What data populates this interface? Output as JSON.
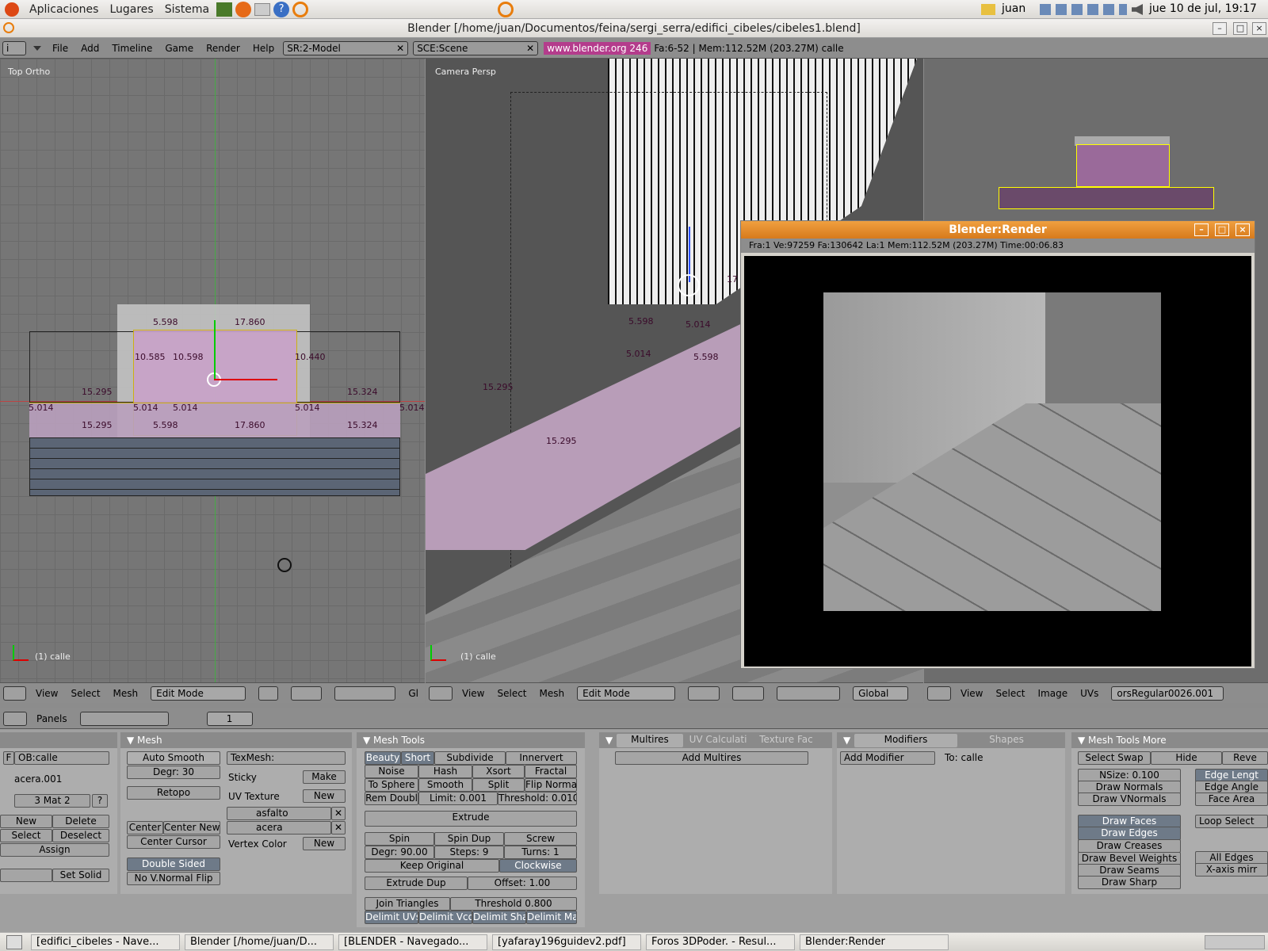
{
  "gnome_panel": {
    "menu_apps": "Aplicaciones",
    "menu_places": "Lugares",
    "menu_system": "Sistema",
    "user": "juan",
    "clock": "jue 10 de jul, 19:17"
  },
  "window": {
    "title": "Blender [/home/juan/Documentos/feina/sergi_serra/edifici_cibeles/cibeles1.blend]"
  },
  "blender_header": {
    "menus": [
      "File",
      "Add",
      "Timeline",
      "Game",
      "Render",
      "Help"
    ],
    "screen": "SR:2-Model",
    "scene": "SCE:Scene",
    "url": "www.blender.org 246",
    "stats": "Fa:6-52 | Mem:112.52M (203.27M) calle"
  },
  "view_left": {
    "label": "Top Ortho",
    "object": "(1) calle",
    "dims": [
      "5.598",
      "17.860",
      "10.585",
      "10.598",
      "10.440",
      "15.295",
      "15.324",
      "5.014",
      "5.014",
      "5.014",
      "5.014",
      "5.014",
      "15.295",
      "5.598",
      "17.860",
      "15.324"
    ]
  },
  "view_center": {
    "label": "Camera Persp",
    "object": "(1) calle",
    "dims": [
      "5.598",
      "5.014",
      "5.014",
      "5.598",
      "15.295",
      "15.295",
      "17"
    ]
  },
  "view_header_left": {
    "menus": [
      "View",
      "Select",
      "Mesh"
    ],
    "mode": "Edit Mode",
    "orient": "Gl"
  },
  "view_header_center": {
    "menus": [
      "View",
      "Select",
      "Mesh"
    ],
    "mode": "Edit Mode",
    "orient": "Global"
  },
  "view_header_right": {
    "menus": [
      "View",
      "Select",
      "Image",
      "UVs"
    ],
    "image": "orsRegular0026.001"
  },
  "render_window": {
    "title": "Blender:Render",
    "info": "Fra:1  Ve:97259 Fa:130642 La:1 Mem:112.52M (203.27M) Time:00:06.83"
  },
  "buttons_header": {
    "panels": "Panels",
    "frame": "1"
  },
  "link_panel": {
    "ob": "OB:calle",
    "mesh": "acera.001",
    "mat": "3 Mat 2",
    "q": "?",
    "new": "New",
    "delete": "Delete",
    "select": "Select",
    "deselect": "Deselect",
    "assign": "Assign",
    "set_solid": "Set Solid"
  },
  "mesh_panel": {
    "title": "Mesh",
    "auto_smooth": "Auto Smooth",
    "degr": "Degr: 30",
    "retopo": "Retopo",
    "center": "Center",
    "center_new": "Center New",
    "center_cursor": "Center Cursor",
    "double_sided": "Double Sided",
    "no_vnormal": "No V.Normal Flip",
    "texmesh": "TexMesh:",
    "sticky": "Sticky",
    "make": "Make",
    "uv_texture": "UV Texture",
    "new": "New",
    "uv1": "asfalto",
    "uv2": "acera",
    "vertex_color": "Vertex Color",
    "new2": "New"
  },
  "mesh_tools": {
    "title": "Mesh Tools",
    "row1": [
      "Beauty",
      "Short",
      "Subdivide",
      "Innervert"
    ],
    "row2": [
      "Noise",
      "Hash",
      "Xsort",
      "Fractal"
    ],
    "row3": [
      "To Sphere",
      "Smooth",
      "Split",
      "Flip Normal"
    ],
    "rem_doubl": "Rem Doubl",
    "limit": "Limit: 0.001",
    "threshold": "Threshold: 0.010",
    "extrude": "Extrude",
    "spin": "Spin",
    "spin_dup": "Spin Dup",
    "screw": "Screw",
    "degr": "Degr: 90.00",
    "steps": "Steps: 9",
    "turns": "Turns: 1",
    "keep_original": "Keep Original",
    "clockwise": "Clockwise",
    "extrude_dup": "Extrude Dup",
    "offset": "Offset: 1.00",
    "join_triangles": "Join Triangles",
    "threshold2": "Threshold 0.800",
    "delimit": [
      "Delimit UVs",
      "Delimit Vcol",
      "Delimit Shar",
      "Delimit Mat"
    ]
  },
  "multires": {
    "tabs": [
      "Multires",
      "UV Calculati",
      "Texture Fac"
    ],
    "add": "Add Multires"
  },
  "modifiers": {
    "tabs": [
      "Modifiers",
      "Shapes"
    ],
    "add": "Add Modifier",
    "to": "To: calle"
  },
  "mesh_tools_more": {
    "title": "Mesh Tools More",
    "select_swap": "Select Swap",
    "hide": "Hide",
    "reveal": "Reve",
    "nsize": "NSize: 0.100",
    "draw_normals": "Draw Normals",
    "draw_vnormals": "Draw VNormals",
    "draw_faces": "Draw Faces",
    "draw_edges": "Draw Edges",
    "draw_creases": "Draw Creases",
    "draw_bevel": "Draw Bevel Weights",
    "draw_seams": "Draw Seams",
    "draw_sharp": "Draw Sharp",
    "edge_length": "Edge Lengt",
    "edge_angle": "Edge Angle",
    "face_area": "Face Area",
    "loop_select": "Loop Select",
    "all_edges": "All Edges",
    "xaxis": "X-axis mirr"
  },
  "taskbar": [
    "[edifici_cibeles - Nave...",
    "Blender [/home/juan/D...",
    "[BLENDER - Navegado...",
    "[yafaray196guidev2.pdf]",
    "Foros 3DPoder. - Resul...",
    "Blender:Render"
  ]
}
